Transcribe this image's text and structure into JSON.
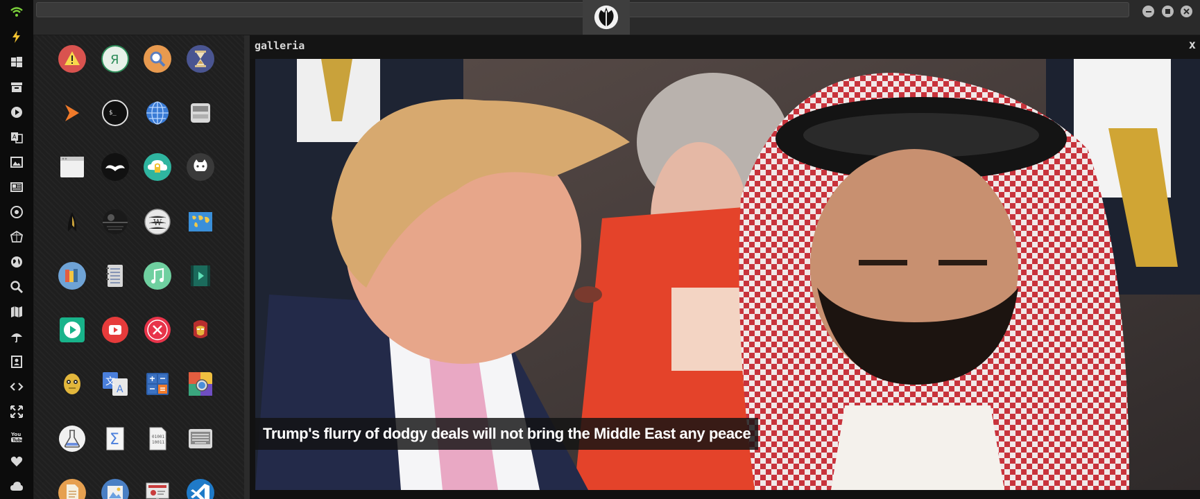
{
  "topbar": {
    "logo_icon": "rebel-alliance-logo-icon",
    "window_controls": [
      "minimize-icon",
      "maximize-icon",
      "close-icon"
    ]
  },
  "dock": {
    "icons": [
      "wifi-icon",
      "lightning-icon",
      "windows-icon",
      "archive-icon",
      "play-circle-icon",
      "translate-icon",
      "image-icon",
      "newspaper-icon",
      "settings-badge-icon",
      "polygon-icon",
      "globe-icon",
      "search-icon",
      "map-icon",
      "umbrella-icon",
      "contact-card-icon",
      "code-icon",
      "fullscreen-icon",
      "youtube-icon",
      "heart-icon",
      "cloud-icon"
    ]
  },
  "launcher": {
    "apps": [
      "warning-app-icon",
      "yandex-app-icon",
      "search-app-icon",
      "hourglass-app-icon",
      "arrow-app-icon",
      "terminal-app-icon",
      "globe-app-icon",
      "scanner-app-icon",
      "window-app-icon",
      "mustache-app-icon",
      "cloud-lock-app-icon",
      "github-app-icon",
      "starfleet-app-icon",
      "death-star-app-icon",
      "wikipedia-app-icon",
      "world-map-app-icon",
      "books-app-icon",
      "notebook-app-icon",
      "music-app-icon",
      "film-app-icon",
      "player-app-icon",
      "youtube-app-icon",
      "close-circle-app-icon",
      "iron-man-app-icon",
      "c3po-app-icon",
      "google-translate-app-icon",
      "calculator-app-icon",
      "color-picker-app-icon",
      "chemistry-app-icon",
      "sigma-app-icon",
      "binary-file-app-icon",
      "keyboard-app-icon",
      "document-app-icon",
      "image-viewer-app-icon",
      "presentation-app-icon",
      "vscode-app-icon"
    ]
  },
  "gallery": {
    "title": "galleria",
    "close_label": "x",
    "caption": "Trump's flurry of dodgy deals will not bring the Middle East any peace"
  }
}
